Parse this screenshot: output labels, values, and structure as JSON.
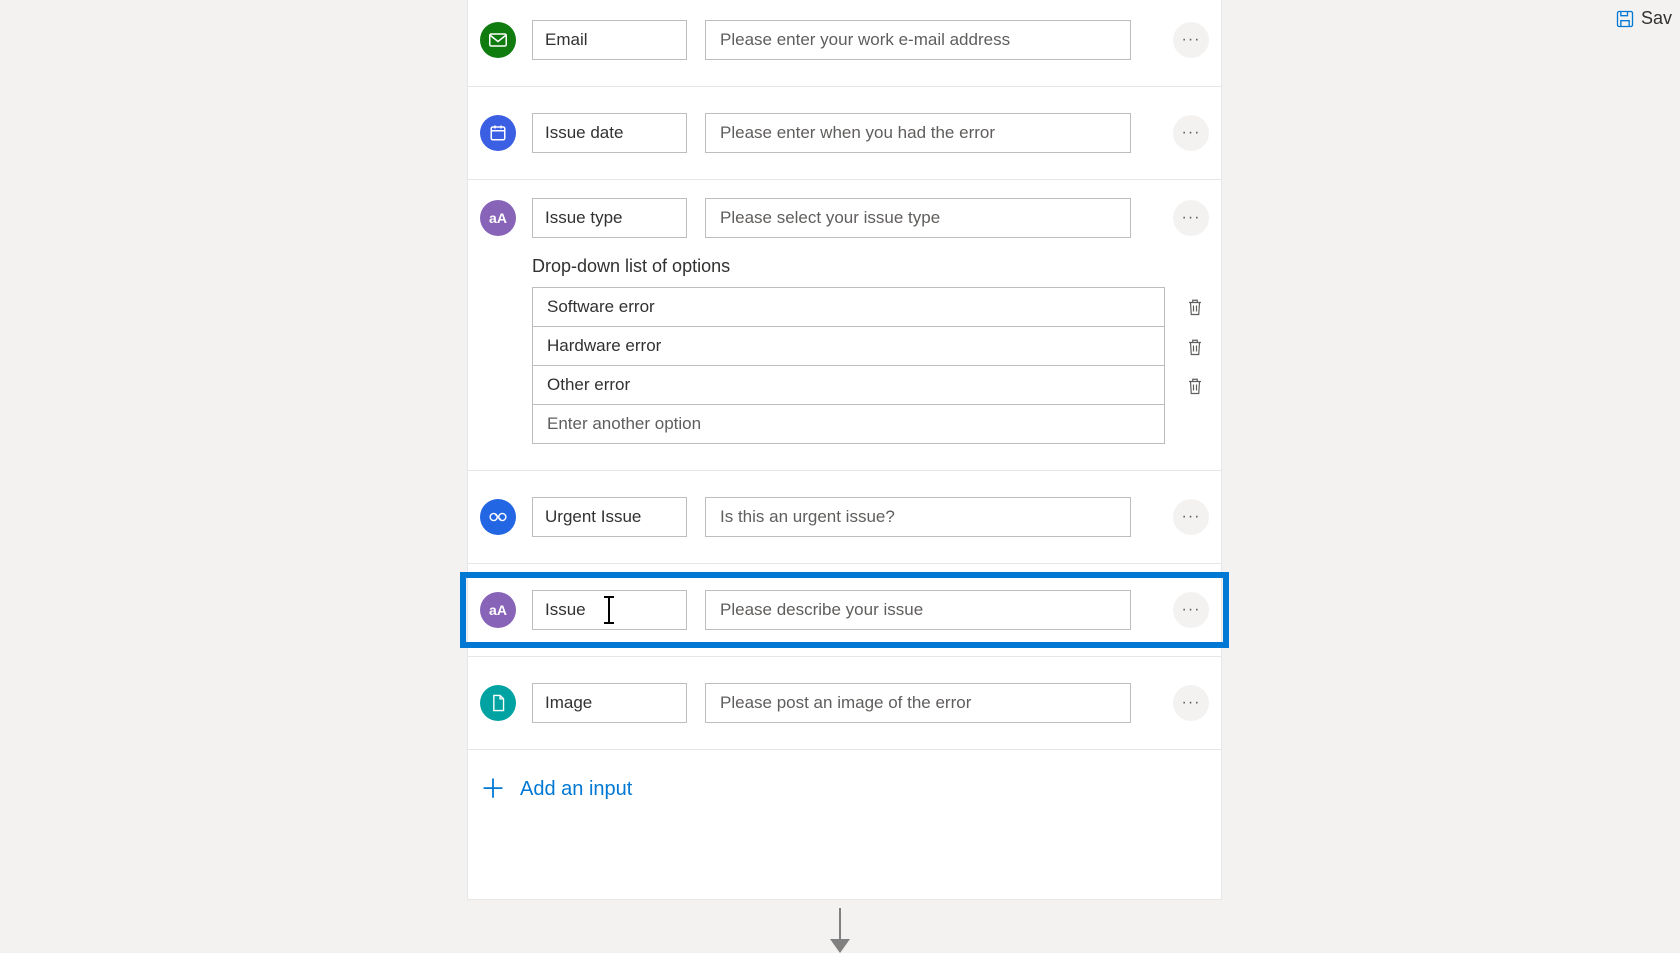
{
  "toolbar": {
    "save": "Sav"
  },
  "rows": {
    "email": {
      "name": "Email",
      "desc": "Please enter your work e-mail address"
    },
    "date": {
      "name": "Issue date",
      "desc": "Please enter when you had the error"
    },
    "type": {
      "name": "Issue type",
      "desc": "Please select your issue type"
    },
    "urgent": {
      "name": "Urgent Issue",
      "desc": "Is this an urgent issue?"
    },
    "issue": {
      "name": "Issue",
      "desc": "Please describe your issue"
    },
    "image": {
      "name": "Image",
      "desc": "Please post an image of the error"
    }
  },
  "dropdown": {
    "label": "Drop-down list of options",
    "options": [
      "Software error",
      "Hardware error",
      "Other error"
    ],
    "placeholder": "Enter another option"
  },
  "addInput": "Add an input"
}
